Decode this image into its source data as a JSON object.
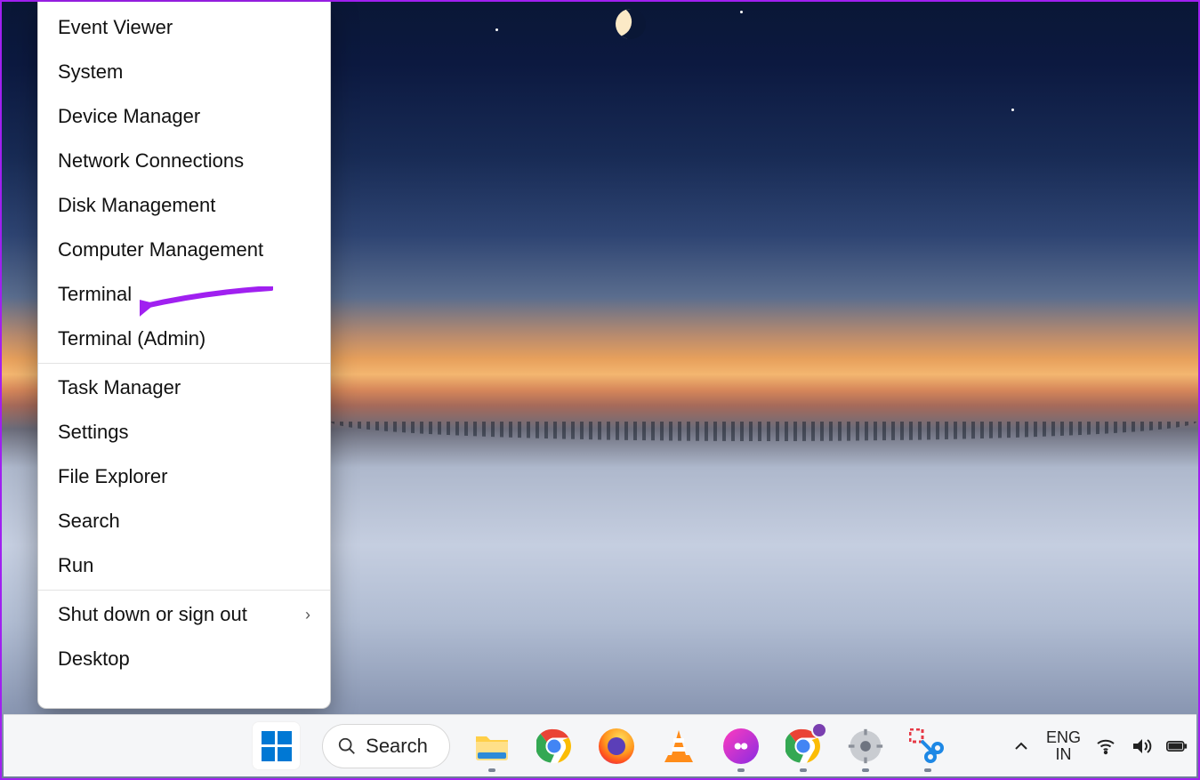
{
  "winx_menu": {
    "groups": [
      {
        "items": [
          {
            "id": "event-viewer",
            "label": "Event Viewer"
          },
          {
            "id": "system",
            "label": "System"
          },
          {
            "id": "device-manager",
            "label": "Device Manager"
          },
          {
            "id": "network-connections",
            "label": "Network Connections"
          },
          {
            "id": "disk-management",
            "label": "Disk Management"
          },
          {
            "id": "computer-management",
            "label": "Computer Management"
          },
          {
            "id": "terminal",
            "label": "Terminal"
          },
          {
            "id": "terminal-admin",
            "label": "Terminal (Admin)"
          }
        ]
      },
      {
        "items": [
          {
            "id": "task-manager",
            "label": "Task Manager"
          },
          {
            "id": "settings",
            "label": "Settings"
          },
          {
            "id": "file-explorer",
            "label": "File Explorer"
          },
          {
            "id": "search",
            "label": "Search"
          },
          {
            "id": "run",
            "label": "Run"
          }
        ]
      },
      {
        "items": [
          {
            "id": "shut-down",
            "label": "Shut down or sign out",
            "submenu": true
          },
          {
            "id": "desktop",
            "label": "Desktop"
          }
        ]
      }
    ]
  },
  "annotation": {
    "target": "terminal",
    "color": "#a020f0"
  },
  "taskbar": {
    "search_label": "Search",
    "pinned": [
      {
        "id": "file-explorer",
        "name": "file-explorer-icon",
        "running": true
      },
      {
        "id": "chrome",
        "name": "chrome-icon",
        "running": false
      },
      {
        "id": "firefox",
        "name": "firefox-icon",
        "running": false
      },
      {
        "id": "vlc",
        "name": "vlc-icon",
        "running": false
      },
      {
        "id": "discord",
        "name": "discord-icon",
        "running": true
      },
      {
        "id": "chrome-profile",
        "name": "chrome-profile-icon",
        "running": true
      },
      {
        "id": "settings",
        "name": "settings-icon",
        "running": true
      },
      {
        "id": "snipping-tool",
        "name": "snipping-tool-icon",
        "running": true
      }
    ],
    "language": {
      "line1": "ENG",
      "line2": "IN"
    },
    "sys_icons": [
      "wifi-icon",
      "volume-icon",
      "battery-icon"
    ]
  }
}
